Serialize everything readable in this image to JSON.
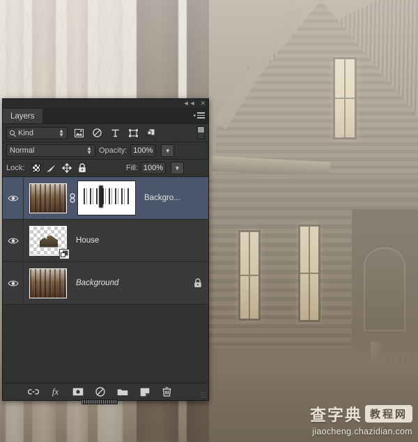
{
  "panel": {
    "titlebar": {
      "collapse_label": "◄◄",
      "close_label": "✕",
      "collapse_icon": "collapse-icon",
      "close_icon": "close-icon"
    },
    "tab_label": "Layers",
    "menu_icon": "panel-menu-icon",
    "filter": {
      "kind_label": "Kind",
      "search_icon": "search-icon",
      "stepper_icon": "stepper-arrows-icon",
      "buttons": [
        {
          "name": "filter-pixel-layers",
          "icon": "image-icon",
          "title": "Filter for pixel layers"
        },
        {
          "name": "filter-adjustment-layers",
          "icon": "adjustment-circle-icon",
          "title": "Filter for adjustment layers"
        },
        {
          "name": "filter-type-layers",
          "icon": "type-icon",
          "title": "Filter for type layers"
        },
        {
          "name": "filter-shape-layers",
          "icon": "shape-icon",
          "title": "Filter for shape layers"
        },
        {
          "name": "filter-smart-objects",
          "icon": "smart-object-icon",
          "title": "Filter for smart objects"
        }
      ],
      "toggle_icon": "filter-toggle-switch"
    },
    "blend": {
      "mode": "Normal",
      "opacity_label": "Opacity:",
      "opacity_value": "100%",
      "opacity_dropdown_icon": "chevron-down-icon"
    },
    "lock": {
      "label": "Lock:",
      "icons": [
        {
          "name": "lock-transparent-pixels-icon",
          "icon": "checkerboard-icon"
        },
        {
          "name": "lock-image-pixels-icon",
          "icon": "brush-icon"
        },
        {
          "name": "lock-position-icon",
          "icon": "move-arrows-icon"
        },
        {
          "name": "lock-all-icon",
          "icon": "padlock-icon"
        }
      ],
      "fill_label": "Fill:",
      "fill_value": "100%",
      "fill_dropdown_icon": "chevron-down-icon"
    },
    "layers": [
      {
        "name": "Backgro...",
        "selected": true,
        "visible": true,
        "italic": false,
        "locked": false,
        "thumb_kind": "forest-photo",
        "has_mask": true,
        "mask_linked": true,
        "link_icon": "chain-link-icon",
        "eye_icon": "eye-icon"
      },
      {
        "name": "House",
        "selected": false,
        "visible": true,
        "italic": false,
        "locked": false,
        "thumb_kind": "transparent-house",
        "has_mask": false,
        "badge_icon": "smart-object-badge-icon",
        "eye_icon": "eye-icon"
      },
      {
        "name": "Background",
        "selected": false,
        "visible": true,
        "italic": true,
        "locked": true,
        "thumb_kind": "forest-photo",
        "has_mask": false,
        "lock_icon": "padlock-icon",
        "eye_icon": "eye-icon"
      }
    ],
    "bottom_buttons": [
      {
        "name": "link-layers-button",
        "icon": "chain-link-icon",
        "glyph": "link"
      },
      {
        "name": "layer-style-button",
        "icon": "fx-icon",
        "glyph": "fx"
      },
      {
        "name": "add-layer-mask-button",
        "icon": "mask-icon",
        "glyph": "mask"
      },
      {
        "name": "new-adjustment-layer-button",
        "icon": "adjustment-circle-icon",
        "glyph": "adj"
      },
      {
        "name": "new-group-button",
        "icon": "folder-icon",
        "glyph": "folder"
      },
      {
        "name": "new-layer-button",
        "icon": "new-layer-icon",
        "glyph": "newlayer"
      },
      {
        "name": "delete-layer-button",
        "icon": "trash-icon",
        "glyph": "trash"
      }
    ],
    "colors": {
      "panel_bg": "#2e2e2e",
      "row_bg": "#3a3a3a",
      "selected_row": "#4b556b",
      "text": "#e3e3e3"
    }
  },
  "watermark": {
    "brand_cn": "查字典",
    "brand_box": "教程网",
    "url": "jiaocheng.chazidian.com"
  },
  "canvas": {
    "description": "Foggy forest photograph with weathered wooden house composited on the right"
  }
}
